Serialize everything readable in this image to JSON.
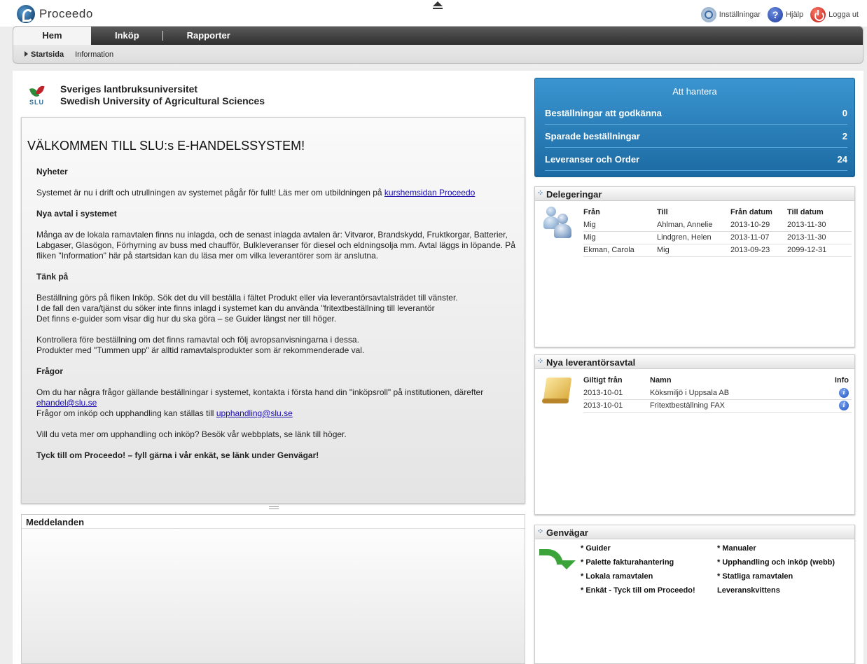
{
  "app": {
    "name": "Proceedo"
  },
  "toplinks": {
    "settings": "Inställningar",
    "help": "Hjälp",
    "logout": "Logga ut"
  },
  "nav": {
    "tabs": [
      "Hem",
      "Inköp",
      "Rapporter"
    ],
    "subtabs": [
      "Startsida",
      "Information"
    ]
  },
  "org": {
    "abbr": "SLU",
    "name_sv": "Sveriges lantbruksuniversitet",
    "name_en": "Swedish University of Agricultural Sciences"
  },
  "welcome": {
    "heading": "VÄLKOMMEN TILL SLU:s E-HANDELSSYSTEM!",
    "news_title": "Nyheter",
    "news_text": "Systemet är nu i drift och utrullningen av systemet pågår för fullt! Läs mer om utbildningen på ",
    "news_link": "kurshemsidan Proceedo",
    "agreements_title": "Nya avtal i systemet",
    "agreements_text": "Många av de lokala ramavtalen finns nu inlagda, och de senast inlagda avtalen är: Vitvaror, Brandskydd, Fruktkorgar, Batterier, Labgaser, Glasögon, Förhyrning av buss med chaufför, Bulkleveranser för diesel och eldningsolja mm. Avtal läggs in löpande. På fliken \"Information\" här på startsidan kan du läsa mer om vilka leverantörer som är anslutna.",
    "think_title": "Tänk på",
    "think_line1": "Beställning görs på fliken Inköp. Sök det du vill beställa i fältet Produkt eller via leverantörsavtalsträdet till vänster.",
    "think_line2": "I de fall den vara/tjänst du söker inte finns inlagd i systemet kan du använda \"fritextbeställning till leverantör",
    "think_line3": "Det finns e-guider som visar dig hur du ska göra – se Guider längst ner till höger.",
    "check_line1": "Kontrollera före beställning om det finns ramavtal och följ avropsanvisningarna i dessa.",
    "check_line2": "Produkter med \"Tummen upp\" är alltid ramavtalsprodukter som är rekommenderade val.",
    "questions_title": "Frågor",
    "questions_text": "Om du har några frågor gällande beställningar i systemet, kontakta i första hand din \"inköpsroll\" på institutionen, därefter ",
    "questions_email": "ehandel@slu.se ",
    "procurement_text": "Frågor om inköp och upphandling kan ställas till ",
    "procurement_email": "upphandling@slu.se ",
    "more_text": "Vill du veta mer om upphandling och inköp? Besök vår webbplats, se länk till höger.",
    "feedback": "Tyck till om Proceedo! – fyll gärna i vår enkät, se länk under Genvägar!"
  },
  "messages": {
    "title": "Meddelanden"
  },
  "att_hantera": {
    "title": "Att hantera",
    "rows": [
      {
        "label": "Beställningar att godkänna",
        "count": "0"
      },
      {
        "label": "Sparade beställningar",
        "count": "2"
      },
      {
        "label": "Leveranser och Order",
        "count": "24"
      }
    ]
  },
  "delegeringar": {
    "title": "Delegeringar",
    "columns": [
      "Från",
      "Till",
      "Från datum",
      "Till datum"
    ],
    "rows": [
      [
        "Mig",
        "Ahlman, Annelie",
        "2013-10-29",
        "2013-11-30"
      ],
      [
        "Mig",
        "Lindgren, Helen",
        "2013-11-07",
        "2013-11-30"
      ],
      [
        "Ekman, Carola",
        "Mig",
        "2013-09-23",
        "2099-12-31"
      ]
    ]
  },
  "leverantorsavtal": {
    "title": "Nya leverantörsavtal",
    "columns": [
      "Giltigt från",
      "Namn",
      "Info"
    ],
    "rows": [
      [
        "2013-10-01",
        "Köksmiljö i Uppsala AB"
      ],
      [
        "2013-10-01",
        "Fritextbeställning FAX"
      ]
    ]
  },
  "genvagar": {
    "title": "Genvägar",
    "left": [
      "* Guider",
      "* Palette fakturahantering",
      "* Lokala ramavtalen",
      "* Enkät - Tyck till om Proceedo!"
    ],
    "right": [
      "* Manualer",
      "* Upphandling och inköp (webb)",
      "* Statliga ramavtalen",
      "Leveranskvittens"
    ]
  }
}
